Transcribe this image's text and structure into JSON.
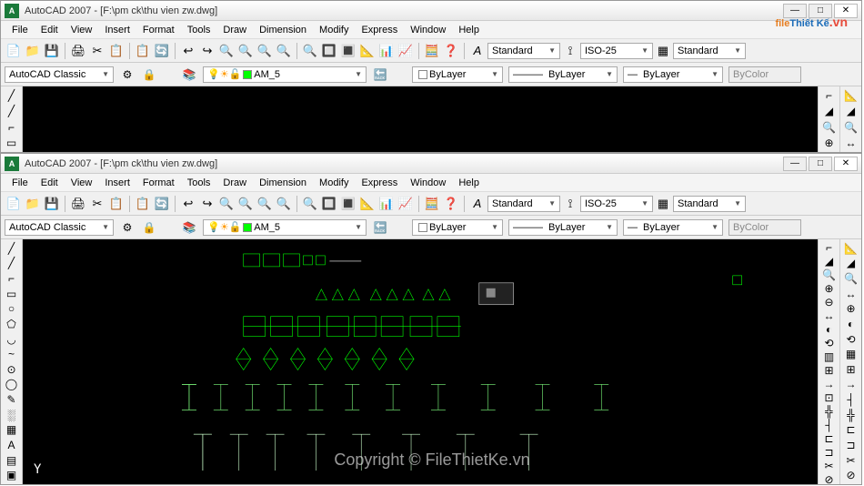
{
  "app": {
    "title": "AutoCAD 2007 - [F:\\pm ck\\thu vien zw.dwg]",
    "icon_text": "A"
  },
  "menus": [
    "File",
    "Edit",
    "View",
    "Insert",
    "Format",
    "Tools",
    "Draw",
    "Dimension",
    "Modify",
    "Express",
    "Window",
    "Help"
  ],
  "workspace": {
    "current": "AutoCAD Classic",
    "layer": "AM_5",
    "layer_control": "ByLayer",
    "linetype": "ByLayer",
    "lineweight": "ByLayer",
    "plotstyle": "ByColor"
  },
  "textstyle": "Standard",
  "dimstyle": "ISO-25",
  "tablestyle": "Standard",
  "watermark": {
    "brand_part1": "file",
    "brand_part2": "Thiết Kế",
    "suffix": ".vn"
  },
  "copyright": "Copyright © FileThietKe.vn",
  "std_icons_row1": [
    "📄",
    "📁",
    "💾",
    "🖨",
    "✂",
    "📋",
    "📋",
    "🔄",
    "↩",
    "↪",
    "🔍",
    "🔍",
    "🔍",
    "🔍",
    "🔍",
    "🔲",
    "🔳",
    "📐",
    "📊",
    "📈",
    "🧮",
    "❓"
  ],
  "layer_icons": [
    "💡",
    "❄",
    "🔒",
    "🎨"
  ],
  "draw_icons": [
    "╱",
    "╱",
    "⌐",
    "▭",
    "○",
    "⬠",
    "◡",
    "~",
    "⊙",
    "◯",
    "✎",
    "░",
    "▦",
    "A",
    "▤",
    "▣"
  ],
  "modify_icons": [
    "⌐",
    "◢",
    "🔍",
    "⊕",
    "⊖",
    "↔",
    "◐",
    "⟲",
    "▥",
    "⊞",
    "→",
    "⊡",
    "╬",
    "┤",
    "⊏",
    "⊐",
    "✂",
    "⊘"
  ],
  "right_icons2": [
    "📐",
    "◢",
    "🔍",
    "↔",
    "⊕",
    "◐",
    "⟲",
    "▦",
    "⊞",
    "→",
    "┤",
    "╬",
    "⊏",
    "⊐",
    "✂",
    "⊘"
  ]
}
